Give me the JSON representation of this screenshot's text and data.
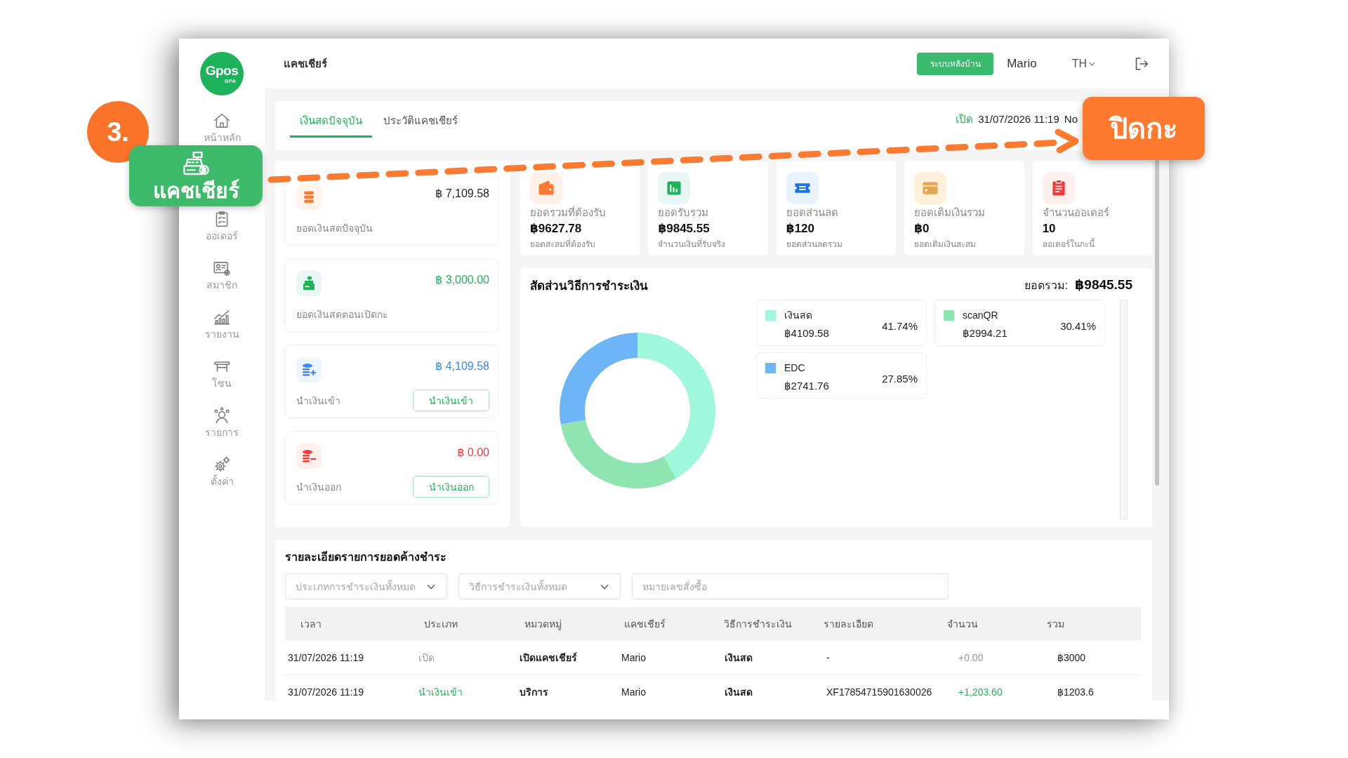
{
  "annotation": {
    "step": "3.",
    "target": "ปิดกะ"
  },
  "sidebar": {
    "logo": {
      "text": "Gpos",
      "sub": "SPA"
    },
    "items": [
      {
        "label": "หน้าหลัก",
        "kind": "home",
        "selected": false
      },
      {
        "label": "แคชเชียร์",
        "kind": "cashier",
        "selected": true
      },
      {
        "label": "ออเดอร์",
        "kind": "orders",
        "selected": false
      },
      {
        "label": "สมาชิก",
        "kind": "members",
        "selected": false
      },
      {
        "label": "รายงาน",
        "kind": "reports",
        "selected": false
      },
      {
        "label": "โซน",
        "kind": "zones",
        "selected": false
      },
      {
        "label": "รายการ",
        "kind": "services",
        "selected": false
      },
      {
        "label": "ตั้งค่า",
        "kind": "settings",
        "selected": false
      }
    ]
  },
  "topbar": {
    "title": "แคชเชียร์",
    "backoffice_button": "ระบบหลังบ้าน",
    "user": "Mario",
    "language": "TH"
  },
  "tabs": [
    {
      "label": "เงินสดปัจจุบัน",
      "selected": true
    },
    {
      "label": "ประวัติแคชเชียร์",
      "selected": false
    }
  ],
  "shift": {
    "status": "เปิด",
    "opened_at": "31/07/2026 11:19",
    "number": "No"
  },
  "cash_cards": [
    {
      "kind": "balance",
      "label": "ยอดเงินสดปัจจุบัน",
      "amount": "฿ 7,109.58"
    },
    {
      "kind": "opening",
      "label": "ยอดเงินสดตอนเปิดกะ",
      "amount": "฿ 3,000.00"
    },
    {
      "kind": "cash_in",
      "label": "นำเงินเข้า",
      "amount": "฿ 4,109.58",
      "button": "นำเงินเข้า"
    },
    {
      "kind": "cash_out",
      "label": "นำเงินออก",
      "amount": "฿ 0.00",
      "button": "นำเงินออก"
    }
  ],
  "stats": [
    {
      "kind": "wallet",
      "label": "ยอดรวมที่ต้องรับ",
      "value": "฿9627.78",
      "note": "ยอดสะสมที่ต้องรับ"
    },
    {
      "kind": "chart",
      "label": "ยอดรับรวม",
      "value": "฿9845.55",
      "note": "จำนวนเงินที่รับจริง"
    },
    {
      "kind": "ticket",
      "label": "ยอดส่วนลด",
      "value": "฿120",
      "note": "ยอดส่วนลดรวม"
    },
    {
      "kind": "card",
      "label": "ยอดเติมเงินรวม",
      "value": "฿0",
      "note": "ยอดเติมเงินสะสม"
    },
    {
      "kind": "clipboard",
      "label": "จำนวนออเดอร์",
      "value": "10",
      "note": "ออเดอร์ในกะนี้"
    }
  ],
  "payment_chart": {
    "title": "สัดส่วนวิธีการชำระเงิน",
    "total_label": "ยอดรวม:",
    "total": "฿9845.55",
    "chart_data": {
      "type": "donut",
      "categories": [
        "เงินสด",
        "scanQR",
        "EDC"
      ],
      "values": [
        41.74,
        30.41,
        27.85
      ]
    },
    "legend": [
      {
        "amount": "฿4109.58",
        "percent": "41.74%",
        "color": "#9ff8dc"
      },
      {
        "amount": "฿2994.21",
        "percent": "30.41%",
        "color": "#8ee5af"
      },
      {
        "amount": "฿2741.76",
        "percent": "27.85%",
        "color": "#6eb5f8"
      }
    ]
  },
  "outstanding": {
    "title": "รายละเอียดรายการยอดค้างชำระ",
    "filters": [
      {
        "kind": "select",
        "placeholder": "ประเภทการชำระเงินทั้งหมด"
      },
      {
        "kind": "select",
        "placeholder": "วิธีการชำระเงินทั้งหมด"
      },
      {
        "kind": "input",
        "placeholder": "หมายเลขสั่งซื้อ"
      }
    ],
    "table": {
      "columns": [
        "เวลา",
        "ประเภท",
        "หมวดหมู่",
        "แคชเชียร์",
        "วิธีการชำระเงิน",
        "รายละเอียด",
        "จำนวน",
        "รวม"
      ],
      "rows": [
        {
          "kind": "open",
          "cells": [
            "31/07/2026 11:19",
            "เปิด",
            "เปิดแคชเชียร์",
            "Mario",
            "เงินสด",
            "-",
            "+0.00",
            "฿3000"
          ]
        },
        {
          "kind": "cash_in",
          "cells": [
            "31/07/2026 11:19",
            "นำเงินเข้า",
            "บริการ",
            "Mario",
            "เงินสด",
            "XF17854715901630026",
            "+1,203.60",
            "฿1203.6"
          ]
        }
      ]
    }
  }
}
